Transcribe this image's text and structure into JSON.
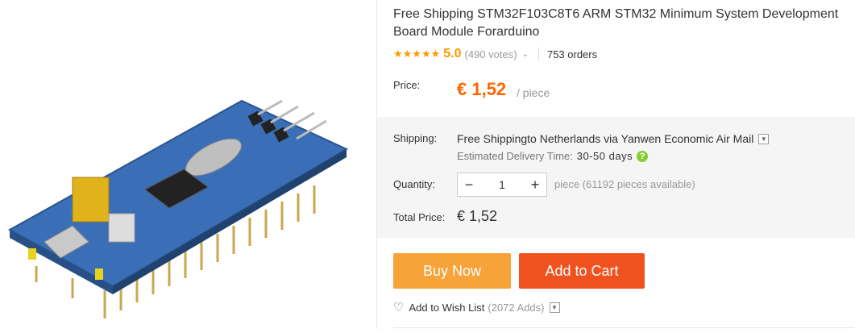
{
  "product": {
    "title": "Free Shipping STM32F103C8T6 ARM STM32 Minimum System Development Board Module Forarduino",
    "stars": "★★★★★",
    "rating": "5.0",
    "votes": "(490 votes)",
    "orders": "753 orders"
  },
  "price": {
    "label": "Price:",
    "value": "€ 1,52",
    "unit": "/ piece"
  },
  "shipping": {
    "label": "Shipping:",
    "text_bold": "Free Shipping",
    "text_rest": " to Netherlands via Yanwen Economic Air Mail",
    "estimated_label": "Estimated Delivery Time:",
    "estimated_days": "30-50 days"
  },
  "quantity": {
    "label": "Quantity:",
    "value": "1",
    "minus": "−",
    "plus": "+",
    "available": "piece (61192 pieces available)"
  },
  "total": {
    "label": "Total Price:",
    "value": "€ 1,52"
  },
  "actions": {
    "buy_now": "Buy Now",
    "add_to_cart": "Add to Cart",
    "wish_list": "Add to Wish List",
    "wish_count": "(2072 Adds)"
  },
  "colors": {
    "price": "#ff6600",
    "buy_now": "#f7a339",
    "add_to_cart": "#f0521f",
    "star": "#ff9900"
  }
}
